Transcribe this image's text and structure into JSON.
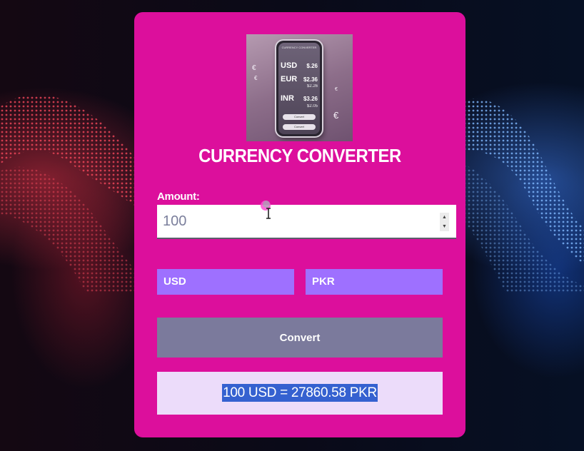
{
  "app": {
    "title": "CURRENCY CONVERTER",
    "accent_color": "#dc0f9c"
  },
  "hero_image": {
    "head_text": "CURRENCY CONVERTER",
    "rates": [
      {
        "code": "USD",
        "value": "$.26"
      },
      {
        "code": "EUR",
        "value": "$2.36"
      },
      {
        "code": "INR",
        "value": "$3.26"
      }
    ],
    "subrates": [
      "$2.26",
      "$2.05"
    ],
    "buttons": [
      "Convert",
      "Convert"
    ],
    "euro_symbol": "€"
  },
  "form": {
    "amount_label": "Amount:",
    "amount_value": "100",
    "from_currency": "USD",
    "to_currency": "PKR",
    "convert_label": "Convert",
    "result_text": "100 USD = 27860.58 PKR",
    "select_color": "#9e70ff",
    "button_color": "#7b7a9c",
    "result_bg_color": "#ecdcfa"
  }
}
